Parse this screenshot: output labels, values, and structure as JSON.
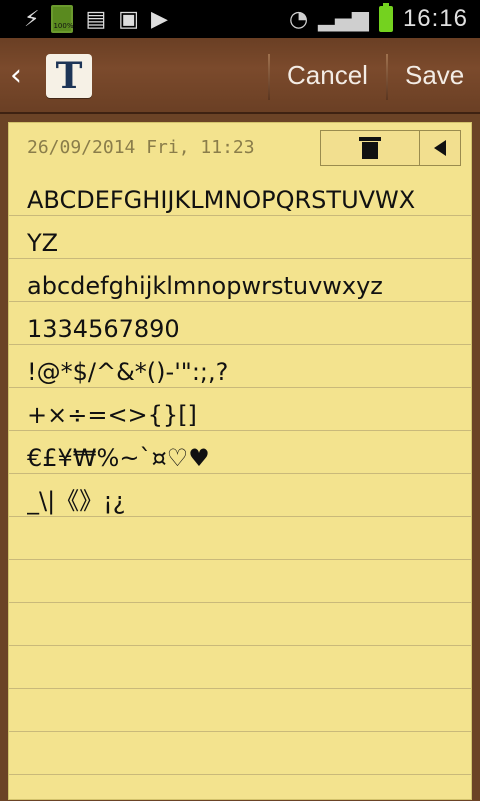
{
  "status_bar": {
    "time": "16:16",
    "battery_small_pct": "100%"
  },
  "app_bar": {
    "back_icon": "back-arrow-icon",
    "font_button_label": "T",
    "cancel_label": "Cancel",
    "save_label": "Save"
  },
  "note": {
    "date": "26/09/2014 Fri, 11:23",
    "lines": [
      "ABCDEFGHIJKLMNOPQRSTUVWX",
      "YZ",
      "abcdefghijklmnopwrstuvwxyz",
      "1334567890",
      "!@*$/^&*()-'\":;,?",
      "+×÷=<>{}[]",
      "€£¥₩%~`¤♡♥",
      "_\\|《》¡¿"
    ]
  },
  "colors": {
    "paper": "#f3e38e",
    "wood": "#6b4326",
    "battery_green": "#74d21f"
  }
}
